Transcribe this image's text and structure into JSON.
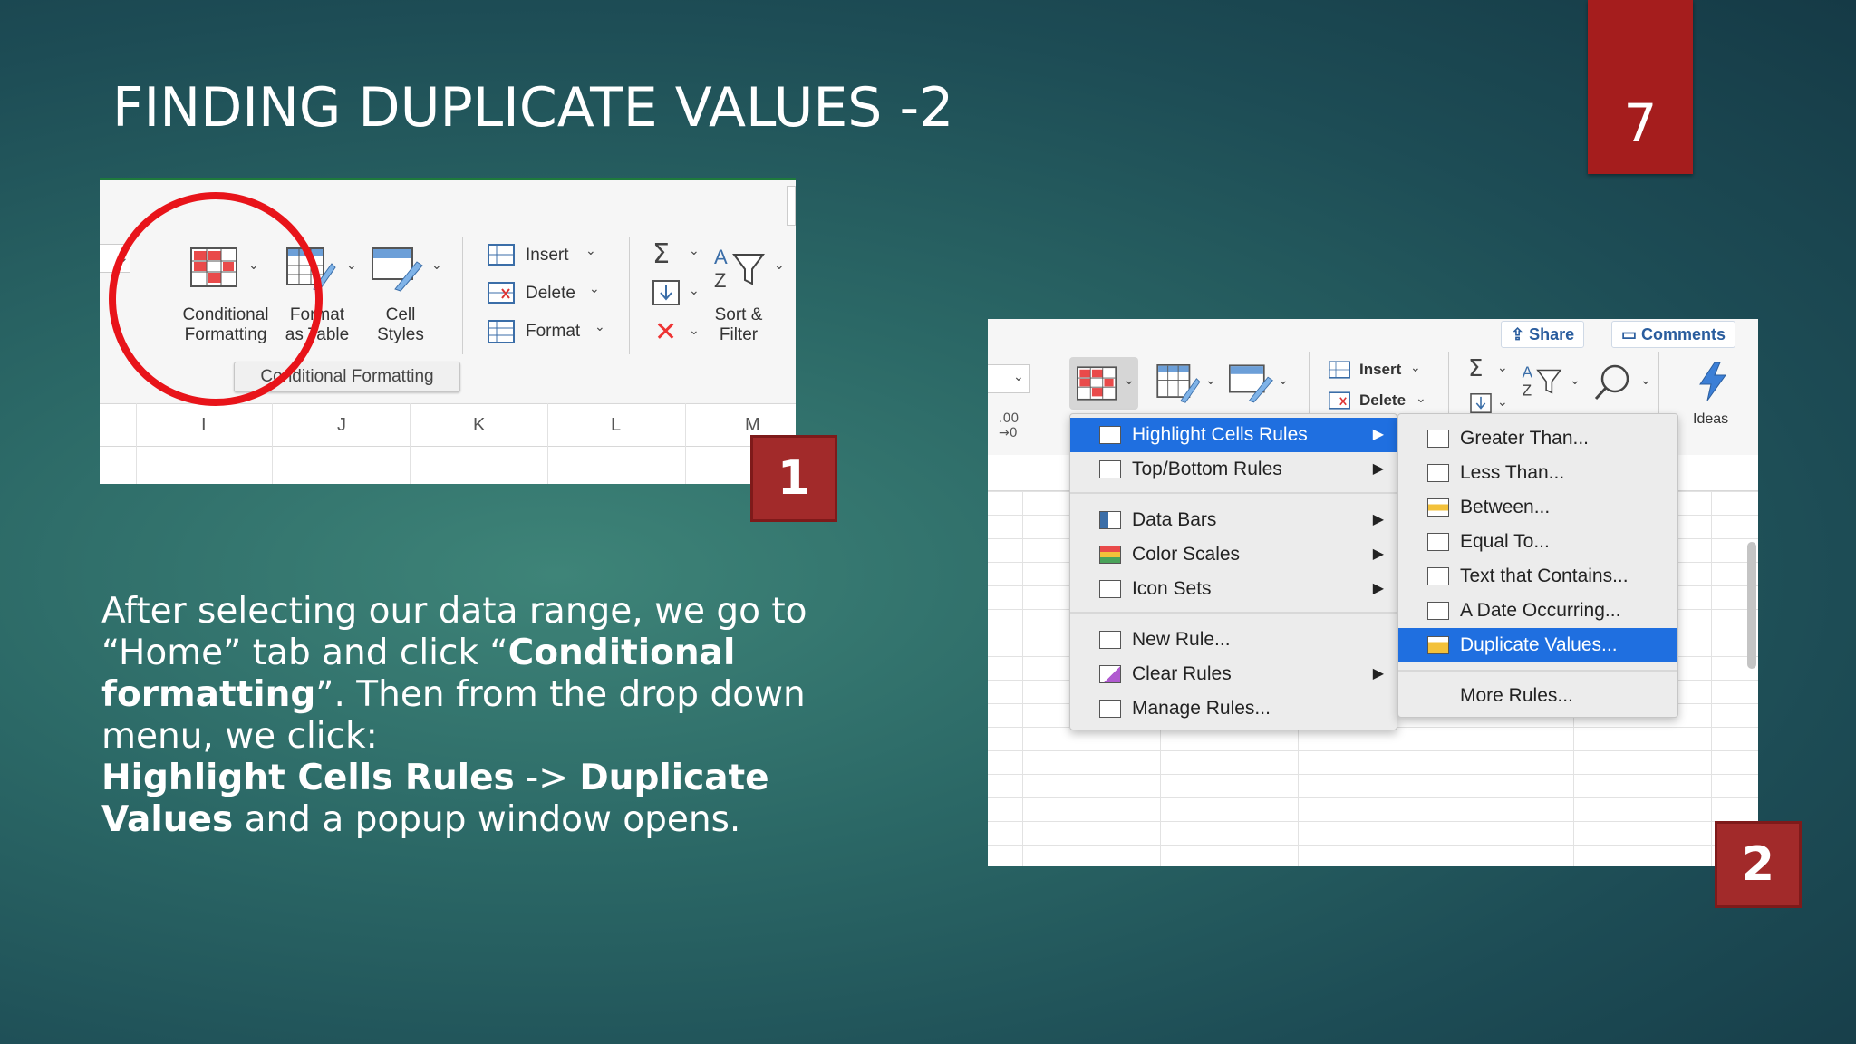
{
  "slide": {
    "title": "FINDING DUPLICATE VALUES -2",
    "number": "7",
    "body": {
      "p1": "After selecting our data range, we go to “Home” tab and click “",
      "p1_bold": "Conditional formatting",
      "p2": "”. Then from the drop down menu, we click:",
      "line2_bold_a": "Highlight Cells Rules",
      "line2_mid": " -> ",
      "line2_bold_b": "Duplicate Values",
      "line2_end": " and a popup window opens."
    }
  },
  "screenshot1": {
    "badge": "1",
    "buttons": {
      "conditional_formatting": [
        "Conditional",
        "Formatting"
      ],
      "format_as_table": [
        "Format",
        "as Table"
      ],
      "cell_styles": [
        "Cell",
        "Styles"
      ],
      "sort_filter": [
        "Sort &",
        "Filter"
      ]
    },
    "cells_group": [
      "Insert",
      "Delete",
      "Format"
    ],
    "tooltip": "Conditional Formatting",
    "columns": [
      "I",
      "J",
      "K",
      "L",
      "M"
    ]
  },
  "screenshot2": {
    "badge": "2",
    "share": "Share",
    "comments": "Comments",
    "insert": "Insert",
    "delete": "Delete",
    "ideas": "Ideas",
    "menu1": [
      {
        "label": "Highlight Cells Rules",
        "submenu": true,
        "selected": true
      },
      {
        "label": "Top/Bottom Rules",
        "submenu": true
      },
      {
        "label": "Data Bars",
        "submenu": true
      },
      {
        "label": "Color Scales",
        "submenu": true
      },
      {
        "label": "Icon Sets",
        "submenu": true
      },
      {
        "label": "New Rule...",
        "submenu": false
      },
      {
        "label": "Clear Rules",
        "submenu": true
      },
      {
        "label": "Manage Rules...",
        "submenu": false
      }
    ],
    "menu2": [
      {
        "label": "Greater Than..."
      },
      {
        "label": "Less Than..."
      },
      {
        "label": "Between..."
      },
      {
        "label": "Equal To..."
      },
      {
        "label": "Text that Contains..."
      },
      {
        "label": "A Date Occurring..."
      },
      {
        "label": "Duplicate Values...",
        "selected": true
      },
      {
        "label": "More Rules..."
      }
    ]
  },
  "colors": {
    "accent_red": "#a51d1d",
    "highlight_blue": "#1f6fe0",
    "circle_red": "#e8141a"
  }
}
